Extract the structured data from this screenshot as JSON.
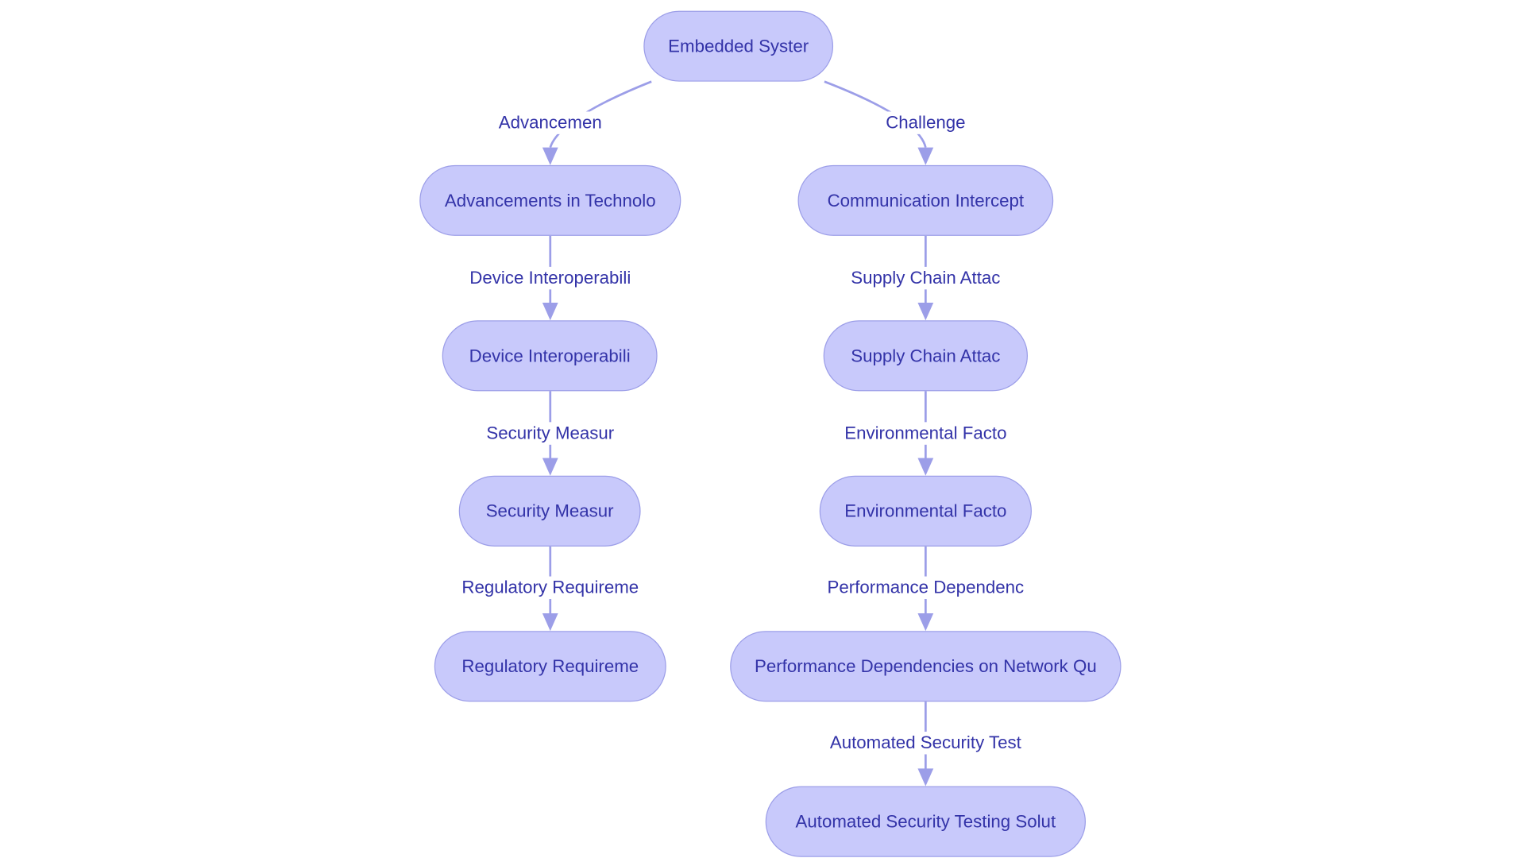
{
  "colors": {
    "node_fill": "#c8c9fb",
    "node_border": "#9c9ee8",
    "edge": "#9c9ee8",
    "text": "#3333a8"
  },
  "nodes": {
    "root": "Embedded Syster",
    "l1": "Advancements in Technolo",
    "l2": "Device Interoperabili",
    "l3": "Security Measur",
    "l4": "Regulatory Requireme",
    "r1": "Communication Intercept",
    "r2": "Supply Chain Attac",
    "r3": "Environmental Facto",
    "r4": "Performance Dependencies on Network Qu",
    "r5": "Automated Security Testing Solut"
  },
  "edges": {
    "root_l1": "Advancemen",
    "root_r1": "Challenge",
    "l1_l2": "Device Interoperabili",
    "l2_l3": "Security Measur",
    "l3_l4": "Regulatory Requireme",
    "r1_r2": "Supply Chain Attac",
    "r2_r3": "Environmental Facto",
    "r3_r4": "Performance Dependenc",
    "r4_r5": "Automated Security Test"
  }
}
